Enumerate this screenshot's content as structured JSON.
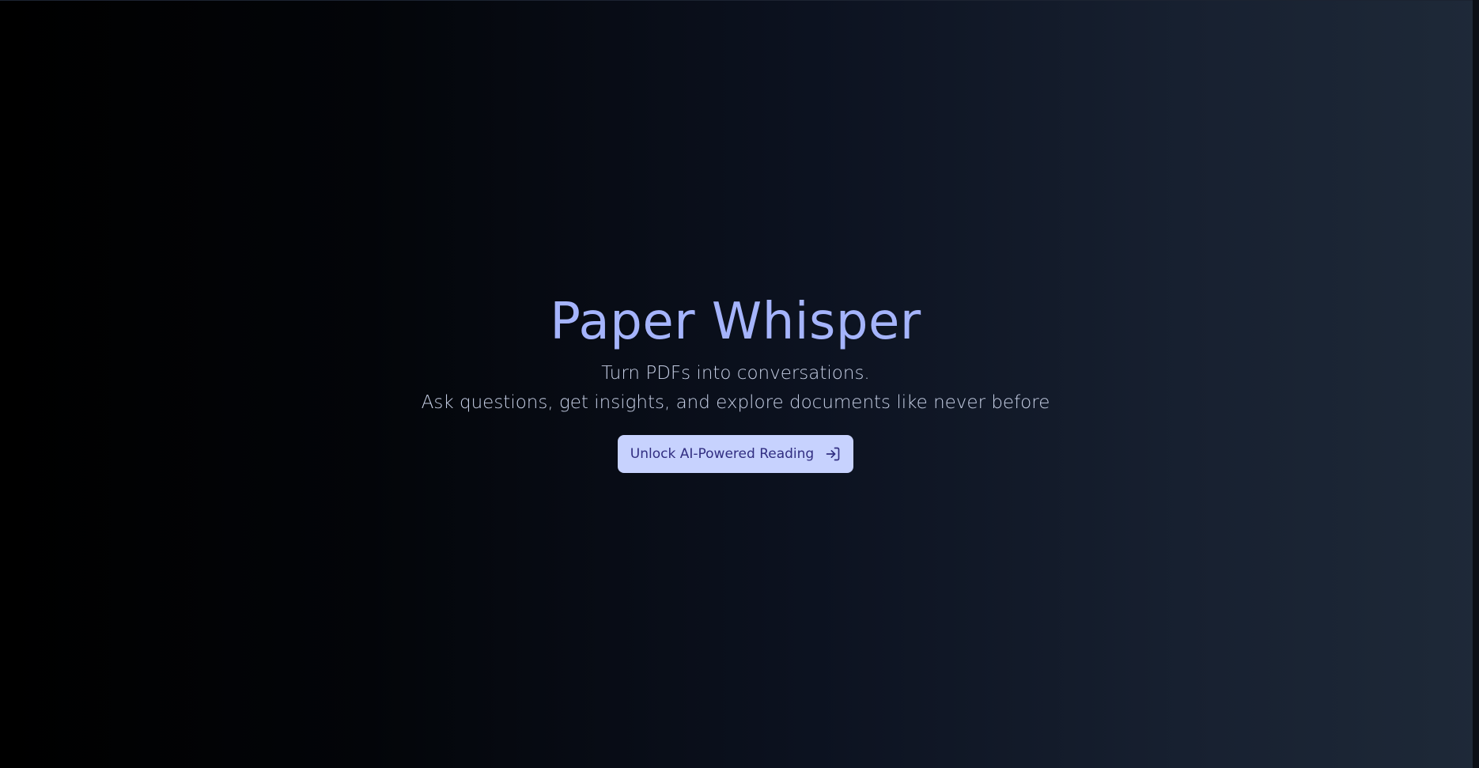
{
  "hero": {
    "title": "Paper Whisper",
    "subtitle_line1": "Turn PDFs into conversations.",
    "subtitle_line2": "Ask questions, get insights, and explore documents like never before",
    "cta_label": "Unlock AI-Powered Reading",
    "cta_icon": "login-icon"
  },
  "colors": {
    "title": "#a5b4fc",
    "subtitle": "#c7d0e6",
    "button_bg": "#c7d2fe",
    "button_text": "#312e81",
    "background_start": "#000000",
    "background_end": "#1e2938"
  }
}
